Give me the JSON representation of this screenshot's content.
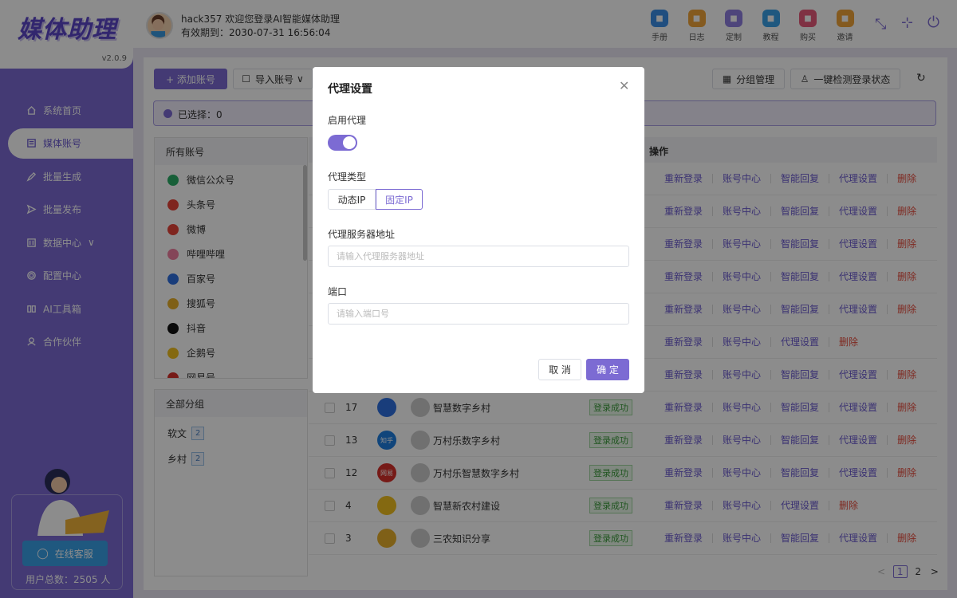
{
  "app": {
    "logo": "媒体助理",
    "version": "v2.0.9"
  },
  "nav": [
    {
      "label": "系统首页",
      "icon": "home-icon"
    },
    {
      "label": "媒体账号",
      "icon": "document-icon",
      "active": true
    },
    {
      "label": "批量生成",
      "icon": "pen-icon"
    },
    {
      "label": "批量发布",
      "icon": "send-icon"
    },
    {
      "label": "数据中心",
      "icon": "chart-icon"
    },
    {
      "label": "配置中心",
      "icon": "gear-icon"
    },
    {
      "label": "AI工具箱",
      "icon": "book-icon"
    },
    {
      "label": "合作伙伴",
      "icon": "user-icon"
    }
  ],
  "support": {
    "button": "在线客服",
    "users": "用户总数：2505 人"
  },
  "header": {
    "greeting": "hack357 欢迎您登录AI智能媒体助理",
    "expiry": "有效期到：2030-07-31 16:56:04",
    "tools": [
      {
        "label": "手册",
        "color": "#3b8ee8"
      },
      {
        "label": "日志",
        "color": "#f0a53a"
      },
      {
        "label": "定制",
        "color": "#8e7ee0"
      },
      {
        "label": "教程",
        "color": "#3aa0e8"
      },
      {
        "label": "购买",
        "color": "#e85a7a"
      },
      {
        "label": "邀请",
        "color": "#f0a53a"
      }
    ]
  },
  "toolbar": {
    "add": "+ 添加账号",
    "import": "导入账号",
    "group_mgmt": "分组管理",
    "check_login": "一键检测登录状态"
  },
  "selected": "已选择：0",
  "accounts_panel": {
    "title": "所有账号",
    "items": [
      {
        "label": "微信公众号",
        "color": "#2aae67"
      },
      {
        "label": "头条号",
        "color": "#e8443a"
      },
      {
        "label": "微博",
        "color": "#e8443a"
      },
      {
        "label": "哔哩哔哩",
        "color": "#f07fa0"
      },
      {
        "label": "百家号",
        "color": "#2f6fe0"
      },
      {
        "label": "搜狐号",
        "color": "#e8b02a"
      },
      {
        "label": "抖音",
        "color": "#111111"
      },
      {
        "label": "企鹅号",
        "color": "#f0c020"
      },
      {
        "label": "网易号",
        "color": "#d8302a"
      }
    ]
  },
  "groups_panel": {
    "title": "全部分组",
    "items": [
      {
        "label": "软文",
        "count": "2"
      },
      {
        "label": "乡村",
        "count": "2"
      }
    ]
  },
  "table": {
    "ops_header": "操作",
    "rows": [
      {
        "id": "",
        "name": "",
        "status": "",
        "platform_color": "",
        "ops": [
          "重新登录",
          "账号中心",
          "智能回复",
          "代理设置",
          "删除"
        ]
      },
      {
        "id": "",
        "name": "",
        "status": "",
        "platform_color": "",
        "ops": [
          "重新登录",
          "账号中心",
          "智能回复",
          "代理设置",
          "删除"
        ]
      },
      {
        "id": "",
        "name": "",
        "status": "",
        "platform_color": "",
        "ops": [
          "重新登录",
          "账号中心",
          "智能回复",
          "代理设置",
          "删除"
        ]
      },
      {
        "id": "",
        "name": "",
        "status": "",
        "platform_color": "",
        "ops": [
          "重新登录",
          "账号中心",
          "智能回复",
          "代理设置",
          "删除"
        ]
      },
      {
        "id": "",
        "name": "",
        "status": "",
        "platform_color": "",
        "ops": [
          "重新登录",
          "账号中心",
          "智能回复",
          "代理设置",
          "删除"
        ]
      },
      {
        "id": "",
        "name": "",
        "status": "",
        "platform_color": "",
        "ops": [
          "重新登录",
          "账号中心",
          "代理设置",
          "删除"
        ]
      },
      {
        "id": "",
        "name": "",
        "status": "",
        "platform_color": "",
        "ops": [
          "重新登录",
          "账号中心",
          "智能回复",
          "代理设置",
          "删除"
        ]
      },
      {
        "id": "17",
        "name": "智慧数字乡村",
        "status": "登录成功",
        "platform_color": "#2f6fe0",
        "ops": [
          "重新登录",
          "账号中心",
          "智能回复",
          "代理设置",
          "删除"
        ]
      },
      {
        "id": "13",
        "name": "万村乐数字乡村",
        "status": "登录成功",
        "platform_color": "#1e7fe0",
        "platform_text": "知乎",
        "ops": [
          "重新登录",
          "账号中心",
          "智能回复",
          "代理设置",
          "删除"
        ]
      },
      {
        "id": "12",
        "name": "万村乐智慧数字乡村",
        "status": "登录成功",
        "platform_color": "#d8302a",
        "platform_text": "网易",
        "ops": [
          "重新登录",
          "账号中心",
          "智能回复",
          "代理设置",
          "删除"
        ]
      },
      {
        "id": "4",
        "name": "智慧新农村建设",
        "status": "登录成功",
        "platform_color": "#f0c020",
        "ops": [
          "重新登录",
          "账号中心",
          "代理设置",
          "删除"
        ]
      },
      {
        "id": "3",
        "name": "三农知识分享",
        "status": "登录成功",
        "platform_color": "#e8b02a",
        "ops": [
          "重新登录",
          "账号中心",
          "智能回复",
          "代理设置",
          "删除"
        ]
      }
    ]
  },
  "pagination": {
    "prev": "<",
    "pages": [
      "1",
      "2"
    ],
    "next": ">"
  },
  "modal": {
    "title": "代理设置",
    "enable_label": "启用代理",
    "enabled": true,
    "type_label": "代理类型",
    "type_options": [
      "动态IP",
      "固定IP"
    ],
    "type_selected": "固定IP",
    "server_label": "代理服务器地址",
    "server_placeholder": "请输入代理服务器地址",
    "server_value": "",
    "port_label": "端口",
    "port_placeholder": "请输入端口号",
    "port_value": "",
    "cancel": "取 消",
    "confirm": "确 定",
    "accent": "#7c6bd3"
  }
}
